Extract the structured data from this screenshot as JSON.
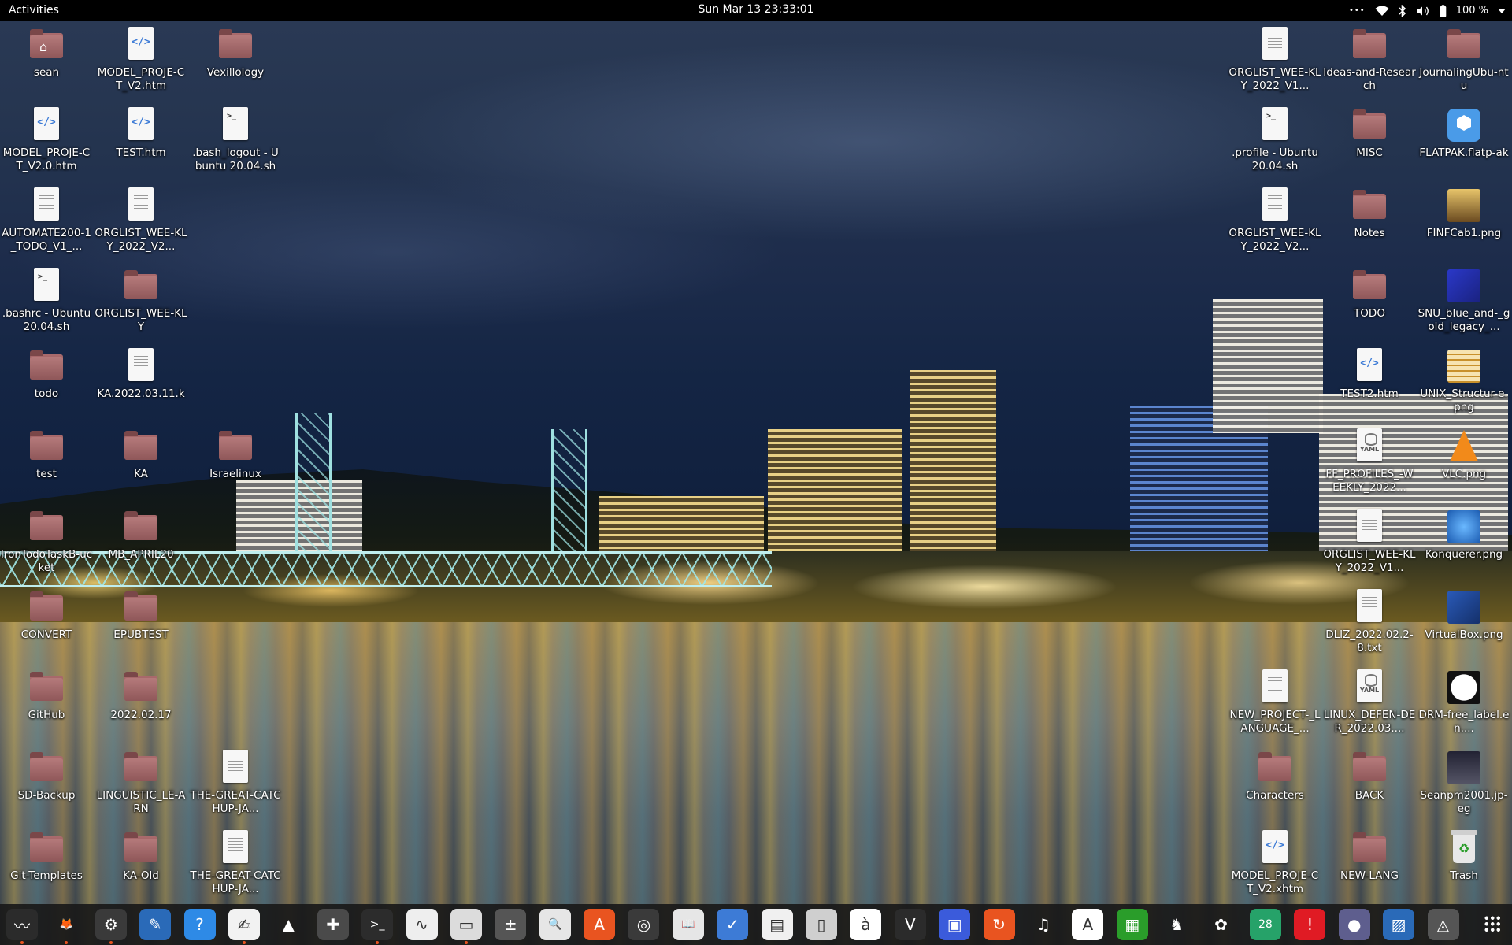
{
  "topbar": {
    "activities": "Activities",
    "clock": "Sun Mar 13  23:33:01",
    "menu_dots": "•••",
    "battery": "100 %"
  },
  "desktop": {
    "icons": [
      {
        "label": "sean",
        "type": "home"
      },
      {
        "label": "MODEL_PROJE-CT_V2.htm",
        "type": "html"
      },
      {
        "label": "Vexillology",
        "type": "folder"
      },
      {
        "label": "MODEL_PROJE-CT_V2.0.htm",
        "type": "html"
      },
      {
        "label": "TEST.htm",
        "type": "html"
      },
      {
        "label": ".bash_logout - Ubuntu 20.04.sh",
        "type": "script"
      },
      {
        "label": "AUTOMATE200-1_TODO_V1_...",
        "type": "text"
      },
      {
        "label": "ORGLIST_WEE-KLY_2022_V2...",
        "type": "text"
      },
      {
        "label": ".bashrc - Ubuntu 20.04.sh",
        "type": "script"
      },
      {
        "label": "ORGLIST_WEE-KLY",
        "type": "folder"
      },
      {
        "label": "todo",
        "type": "folder"
      },
      {
        "label": "KA.2022.03.11.k",
        "type": "text"
      },
      {
        "label": "test",
        "type": "folder"
      },
      {
        "label": "KA",
        "type": "folder"
      },
      {
        "label": "Israelinux",
        "type": "folder"
      },
      {
        "label": "IronTodoTaskB-ucket",
        "type": "folder"
      },
      {
        "label": "MB_APRIL20",
        "type": "folder"
      },
      {
        "label": "CONVERT",
        "type": "folder"
      },
      {
        "label": "EPUBTEST",
        "type": "folder"
      },
      {
        "label": "GitHub",
        "type": "folder"
      },
      {
        "label": "2022.02.17",
        "type": "folder"
      },
      {
        "label": "SD-Backup",
        "type": "folder"
      },
      {
        "label": "LINGUISTIC_LE-ARN",
        "type": "folder"
      },
      {
        "label": "THE-GREAT-CATCHUP-JA...",
        "type": "text"
      },
      {
        "label": "Git-Templates",
        "type": "folder"
      },
      {
        "label": "KA-Old",
        "type": "folder"
      },
      {
        "label": "THE-GREAT-CATCHUP-JA...",
        "type": "text"
      },
      {
        "label": "ORGLIST_WEE-KLY_2022_V1...",
        "type": "text"
      },
      {
        "label": "Ideas-and-Research",
        "type": "folder"
      },
      {
        "label": "JournalingUbu-ntu",
        "type": "folder"
      },
      {
        "label": ".profile - Ubuntu 20.04.sh",
        "type": "script"
      },
      {
        "label": "MISC",
        "type": "folder"
      },
      {
        "label": "FLATPAK.flatp-ak",
        "type": "flatpak"
      },
      {
        "label": "ORGLIST_WEE-KLY_2022_V2...",
        "type": "text"
      },
      {
        "label": "Notes",
        "type": "folder"
      },
      {
        "label": "FINFCab1.png",
        "type": "image"
      },
      {
        "label": "TODO",
        "type": "folder"
      },
      {
        "label": "SNU_blue_and-_gold_legacy_...",
        "type": "image"
      },
      {
        "label": "TEST2.htm",
        "type": "html"
      },
      {
        "label": "UNIX_Structur-e.png",
        "type": "image"
      },
      {
        "label": "FF_PROFILES_-WEEKLY_2022...",
        "type": "yaml"
      },
      {
        "label": "VLC.png",
        "type": "image"
      },
      {
        "label": "ORGLIST_WEE-KLY_2022_V1...",
        "type": "text"
      },
      {
        "label": "Konquerer.png",
        "type": "image"
      },
      {
        "label": "DLIZ_2022.02.2-8.txt",
        "type": "text"
      },
      {
        "label": "VirtualBox.png",
        "type": "image"
      },
      {
        "label": "NEW_PROJECT-_LANGUAGE_...",
        "type": "text"
      },
      {
        "label": "LINUX_DEFEN-DER_2022.03....",
        "type": "yaml"
      },
      {
        "label": "DRM-free_label.en....",
        "type": "image"
      },
      {
        "label": "Characters",
        "type": "folder"
      },
      {
        "label": "BACK",
        "type": "folder"
      },
      {
        "label": "Seanpm2001.jp-eg",
        "type": "image"
      },
      {
        "label": "MODEL_PROJE-CT_V2.xhtm",
        "type": "html"
      },
      {
        "label": "NEW-LANG",
        "type": "folder"
      },
      {
        "label": "Trash",
        "type": "trash"
      }
    ]
  },
  "dock": {
    "items": [
      {
        "name": "system-monitor",
        "glyph": "〰",
        "bg": "#2b2b2b",
        "running": true
      },
      {
        "name": "firefox",
        "glyph": "🦊",
        "bg": "transparent",
        "running": true
      },
      {
        "name": "settings",
        "glyph": "⚙",
        "bg": "#3a3a3a",
        "running": true
      },
      {
        "name": "libreoffice-writer",
        "glyph": "✎",
        "bg": "#2a6ab8",
        "running": false
      },
      {
        "name": "help",
        "glyph": "?",
        "bg": "#2e8ae6",
        "running": false
      },
      {
        "name": "text-editor",
        "glyph": "✍",
        "bg": "#f2f2f2",
        "running": true
      },
      {
        "name": "vlc",
        "glyph": "▲",
        "bg": "transparent",
        "running": false
      },
      {
        "name": "puzzle",
        "glyph": "✚",
        "bg": "#4a4a4a",
        "running": false
      },
      {
        "name": "terminal",
        "glyph": ">_",
        "bg": "#2c2c2c",
        "running": true
      },
      {
        "name": "system-monitor-graph",
        "glyph": "∿",
        "bg": "#eeeeee",
        "running": false
      },
      {
        "name": "files",
        "glyph": "▭",
        "bg": "#dcdcdc",
        "running": true
      },
      {
        "name": "calculator",
        "glyph": "±",
        "bg": "#555",
        "running": false
      },
      {
        "name": "image-viewer",
        "glyph": "🔍",
        "bg": "#e6e6e6",
        "running": false
      },
      {
        "name": "software",
        "glyph": "A",
        "bg": "#e95420",
        "running": false
      },
      {
        "name": "disk-utility",
        "glyph": "◎",
        "bg": "#3a3a3a",
        "running": false
      },
      {
        "name": "book-reader",
        "glyph": "📖",
        "bg": "#e6e6e6",
        "running": false
      },
      {
        "name": "tasks",
        "glyph": "✓",
        "bg": "#3d7bd6",
        "running": false
      },
      {
        "name": "notes",
        "glyph": "▤",
        "bg": "#f0f0f0",
        "running": false
      },
      {
        "name": "archive-manager",
        "glyph": "▯",
        "bg": "#cfcfcf",
        "running": false
      },
      {
        "name": "character-map",
        "glyph": "à",
        "bg": "#ffffff",
        "running": false
      },
      {
        "name": "vim",
        "glyph": "V",
        "bg": "#2b2b2b",
        "running": false
      },
      {
        "name": "screen-share",
        "glyph": "▣",
        "bg": "#3b5bdb",
        "running": false
      },
      {
        "name": "updater",
        "glyph": "↻",
        "bg": "#e95420",
        "running": false
      },
      {
        "name": "music",
        "glyph": "♫",
        "bg": "transparent",
        "running": false
      },
      {
        "name": "document-viewer",
        "glyph": "A",
        "bg": "#ffffff",
        "running": false
      },
      {
        "name": "spreadsheet",
        "glyph": "▦",
        "bg": "#2a9d2a",
        "running": false
      },
      {
        "name": "game",
        "glyph": "♞",
        "bg": "transparent",
        "running": false
      },
      {
        "name": "gimp",
        "glyph": "✿",
        "bg": "transparent",
        "running": false
      },
      {
        "name": "calendar",
        "glyph": "28",
        "bg": "#26a269",
        "running": false
      },
      {
        "name": "alert",
        "glyph": "!",
        "bg": "#e01b24",
        "running": false
      },
      {
        "name": "camera",
        "glyph": "●",
        "bg": "#5e5e8e",
        "running": false
      },
      {
        "name": "screenshot",
        "glyph": "▨",
        "bg": "#2a6ab8",
        "running": false
      },
      {
        "name": "app-center",
        "glyph": "◬",
        "bg": "#555",
        "running": false
      }
    ]
  }
}
